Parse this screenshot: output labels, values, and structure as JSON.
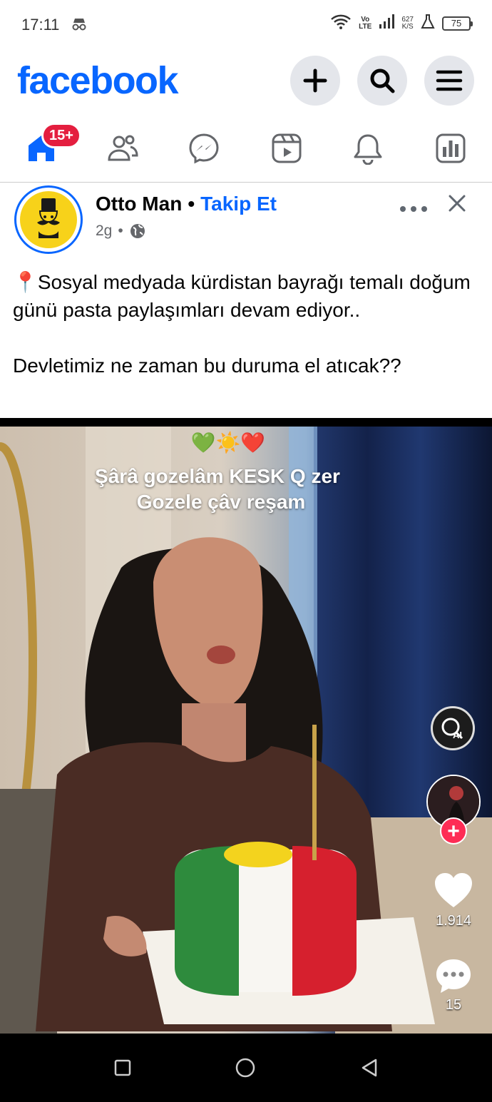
{
  "status_bar": {
    "time": "17:11",
    "volte_top": "Vo",
    "volte_bottom": "LTE",
    "speed_value": "627",
    "speed_unit": "K/S",
    "battery": "75"
  },
  "header": {
    "logo": "facebook",
    "brand_color": "#0866ff"
  },
  "nav": {
    "home_badge": "15+",
    "items": [
      "home-icon",
      "friends-icon",
      "messenger-icon",
      "video-icon",
      "bell-icon",
      "dashboard-icon"
    ]
  },
  "post": {
    "author": "Otto Man",
    "separator": "•",
    "follow_label": "Takip Et",
    "time": "2g",
    "meta_separator": "•",
    "pin_emoji": "📍",
    "text_line1": "Sosyal medyada kürdistan bayrağı temalı doğum günü pasta paylaşımları devam ediyor..",
    "text_line2": "Devletimiz ne zaman bu duruma el atıcak??"
  },
  "video": {
    "emojis": "💚☀️❤️",
    "caption_line1": "Şârâ gozelâm KESK Q zer",
    "caption_line2": "Gozele çâv reşam",
    "like_count": "1.914",
    "comment_count": "15"
  }
}
